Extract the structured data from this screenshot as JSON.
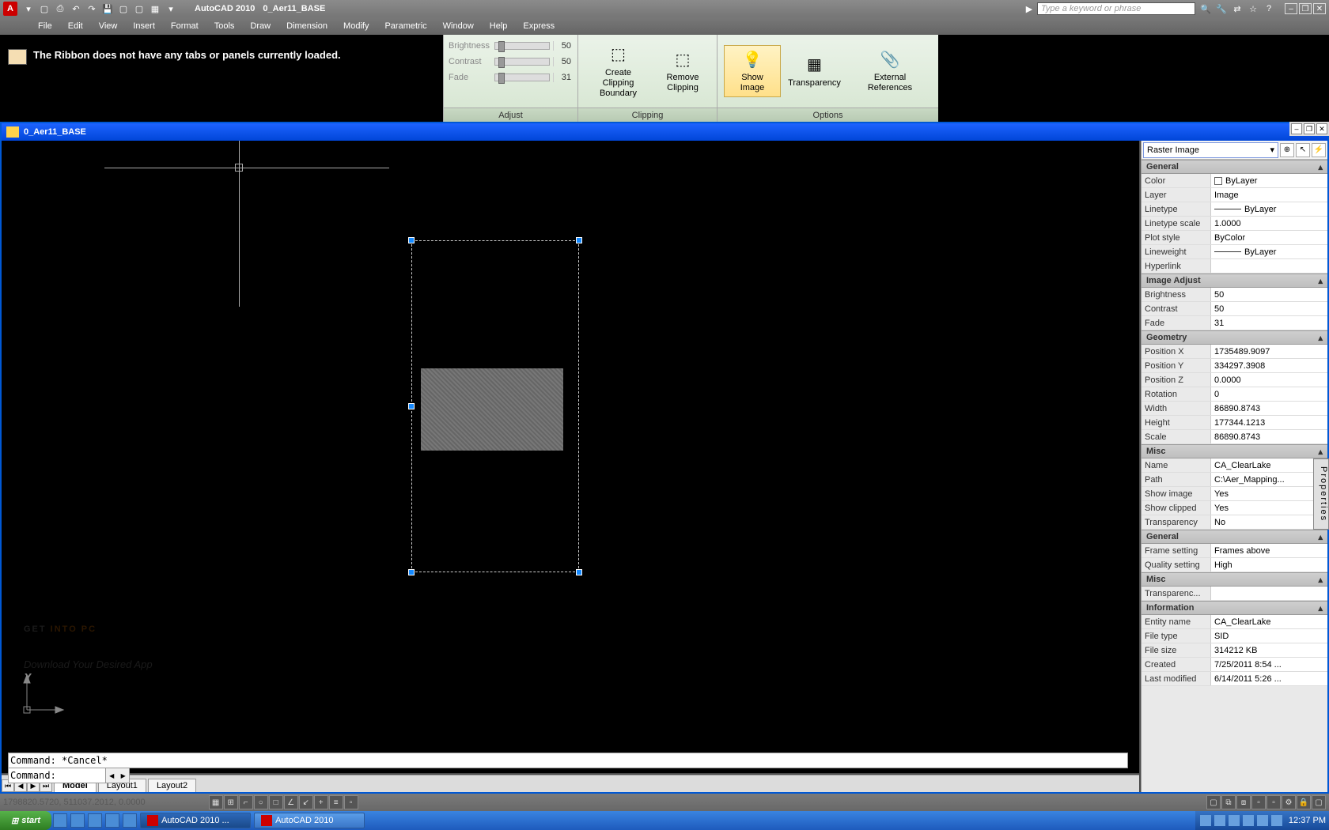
{
  "titlebar": {
    "app_name": "AutoCAD 2010",
    "doc_name": "0_Aer11_BASE",
    "search_placeholder": "Type a keyword or phrase"
  },
  "menubar": [
    "File",
    "Edit",
    "View",
    "Insert",
    "Format",
    "Tools",
    "Draw",
    "Dimension",
    "Modify",
    "Parametric",
    "Window",
    "Help",
    "Express"
  ],
  "ribbon": {
    "message": "The Ribbon does not have any tabs or panels currently loaded.",
    "adjust": {
      "title": "Adjust",
      "rows": [
        {
          "label": "Brightness",
          "value": "50"
        },
        {
          "label": "Contrast",
          "value": "50"
        },
        {
          "label": "Fade",
          "value": "31"
        }
      ]
    },
    "clipping": {
      "title": "Clipping",
      "buttons": [
        {
          "label": "Create Clipping Boundary"
        },
        {
          "label": "Remove Clipping"
        }
      ]
    },
    "options": {
      "title": "Options",
      "buttons": [
        {
          "label": "Show Image",
          "active": true
        },
        {
          "label": "Transparency"
        },
        {
          "label": "External References"
        }
      ]
    }
  },
  "drawing": {
    "window_title": "0_Aer11_BASE",
    "watermark1a": "GET ",
    "watermark1b": "INTO PC",
    "watermark2": "Download Your Desired App",
    "ucs_y": "Y",
    "ucs_x": "X",
    "tabs": [
      "Model",
      "Layout1",
      "Layout2"
    ]
  },
  "properties": {
    "selector": "Raster Image",
    "groups": [
      {
        "name": "General",
        "rows": [
          {
            "k": "Color",
            "v": "ByLayer",
            "swatch": true
          },
          {
            "k": "Layer",
            "v": "Image"
          },
          {
            "k": "Linetype",
            "v": "ByLayer",
            "line": true
          },
          {
            "k": "Linetype scale",
            "v": "1.0000"
          },
          {
            "k": "Plot style",
            "v": "ByColor"
          },
          {
            "k": "Lineweight",
            "v": "ByLayer",
            "line": true
          },
          {
            "k": "Hyperlink",
            "v": ""
          }
        ]
      },
      {
        "name": "Image Adjust",
        "rows": [
          {
            "k": "Brightness",
            "v": "50"
          },
          {
            "k": "Contrast",
            "v": "50"
          },
          {
            "k": "Fade",
            "v": "31"
          }
        ]
      },
      {
        "name": "Geometry",
        "rows": [
          {
            "k": "Position X",
            "v": "1735489.9097"
          },
          {
            "k": "Position Y",
            "v": "334297.3908"
          },
          {
            "k": "Position Z",
            "v": "0.0000"
          },
          {
            "k": "Rotation",
            "v": "0"
          },
          {
            "k": "Width",
            "v": "86890.8743"
          },
          {
            "k": "Height",
            "v": "177344.1213"
          },
          {
            "k": "Scale",
            "v": "86890.8743"
          }
        ]
      },
      {
        "name": "Misc",
        "rows": [
          {
            "k": "Name",
            "v": "CA_ClearLake"
          },
          {
            "k": "Path",
            "v": "C:\\Aer_Mapping..."
          },
          {
            "k": "Show image",
            "v": "Yes"
          },
          {
            "k": "Show clipped",
            "v": "Yes"
          },
          {
            "k": "Transparency",
            "v": "No"
          }
        ]
      },
      {
        "name": "General",
        "rows": [
          {
            "k": "Frame setting",
            "v": "Frames above"
          },
          {
            "k": "Quality setting",
            "v": "High"
          }
        ]
      },
      {
        "name": "Misc",
        "rows": [
          {
            "k": "Transparenc...",
            "v": ""
          }
        ]
      },
      {
        "name": "Information",
        "rows": [
          {
            "k": "Entity name",
            "v": "CA_ClearLake"
          },
          {
            "k": "File type",
            "v": "SID"
          },
          {
            "k": "File size",
            "v": "314212 KB"
          },
          {
            "k": "Created",
            "v": "7/25/2011 8:54 ..."
          },
          {
            "k": "Last modified",
            "v": "6/14/2011 5:26 ..."
          }
        ]
      }
    ],
    "side_tab": "Properties"
  },
  "commandline": {
    "history": "Command: *Cancel*",
    "prompt": "Command:"
  },
  "statusbar": {
    "coords": "1798820.5720, 511037.2012, 0.0000"
  },
  "taskbar": {
    "start": "start",
    "task1": "AutoCAD 2010 ...",
    "task2": "AutoCAD 2010",
    "clock": "12:37 PM"
  }
}
